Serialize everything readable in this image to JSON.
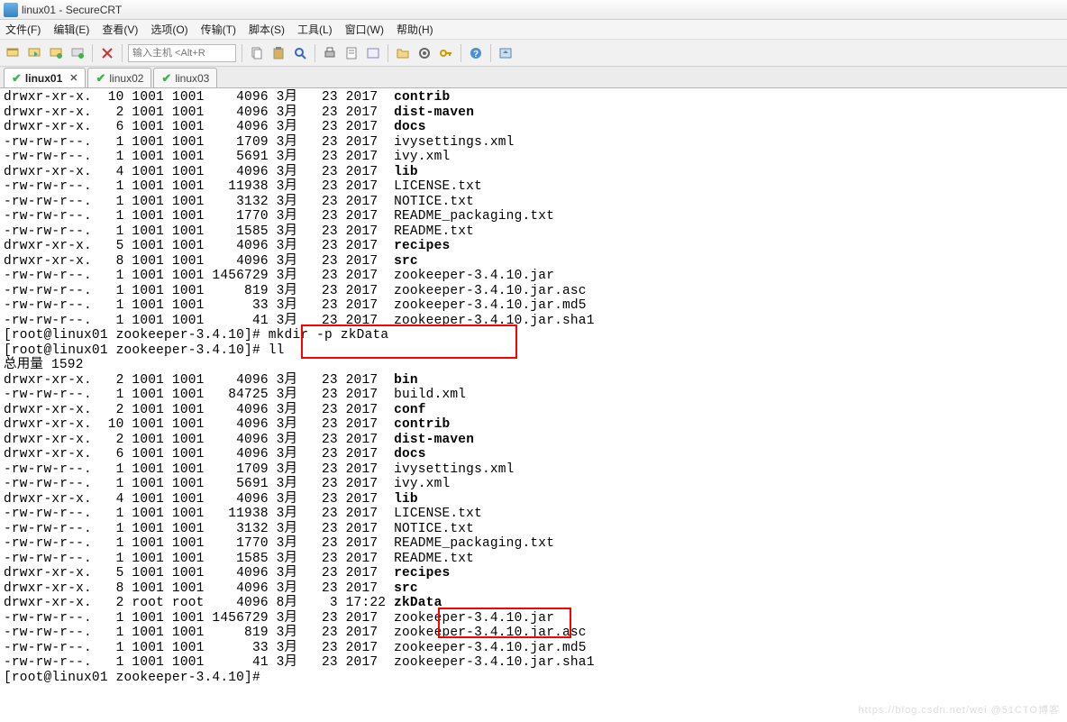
{
  "window": {
    "title": "linux01 - SecureCRT"
  },
  "menu": {
    "file": "文件(F)",
    "edit": "编辑(E)",
    "view": "查看(V)",
    "options": "选项(O)",
    "transfer": "传输(T)",
    "script": "脚本(S)",
    "tools": "工具(L)",
    "window": "窗口(W)",
    "help": "帮助(H)"
  },
  "toolbar": {
    "host_placeholder": "输入主机 <Alt+R"
  },
  "tabs": [
    {
      "label": "linux01",
      "active": true
    },
    {
      "label": "linux02",
      "active": false
    },
    {
      "label": "linux03",
      "active": false
    }
  ],
  "listing_top": [
    {
      "perm": "drwxr-xr-x.",
      "links": "10",
      "own": "1001",
      "grp": "1001",
      "size": "4096",
      "month": "3月",
      "day": "23",
      "time": "2017",
      "name": "contrib",
      "bold": true
    },
    {
      "perm": "drwxr-xr-x.",
      "links": "2",
      "own": "1001",
      "grp": "1001",
      "size": "4096",
      "month": "3月",
      "day": "23",
      "time": "2017",
      "name": "dist-maven",
      "bold": true
    },
    {
      "perm": "drwxr-xr-x.",
      "links": "6",
      "own": "1001",
      "grp": "1001",
      "size": "4096",
      "month": "3月",
      "day": "23",
      "time": "2017",
      "name": "docs",
      "bold": true
    },
    {
      "perm": "-rw-rw-r--.",
      "links": "1",
      "own": "1001",
      "grp": "1001",
      "size": "1709",
      "month": "3月",
      "day": "23",
      "time": "2017",
      "name": "ivysettings.xml",
      "bold": false
    },
    {
      "perm": "-rw-rw-r--.",
      "links": "1",
      "own": "1001",
      "grp": "1001",
      "size": "5691",
      "month": "3月",
      "day": "23",
      "time": "2017",
      "name": "ivy.xml",
      "bold": false
    },
    {
      "perm": "drwxr-xr-x.",
      "links": "4",
      "own": "1001",
      "grp": "1001",
      "size": "4096",
      "month": "3月",
      "day": "23",
      "time": "2017",
      "name": "lib",
      "bold": true
    },
    {
      "perm": "-rw-rw-r--.",
      "links": "1",
      "own": "1001",
      "grp": "1001",
      "size": "11938",
      "month": "3月",
      "day": "23",
      "time": "2017",
      "name": "LICENSE.txt",
      "bold": false
    },
    {
      "perm": "-rw-rw-r--.",
      "links": "1",
      "own": "1001",
      "grp": "1001",
      "size": "3132",
      "month": "3月",
      "day": "23",
      "time": "2017",
      "name": "NOTICE.txt",
      "bold": false
    },
    {
      "perm": "-rw-rw-r--.",
      "links": "1",
      "own": "1001",
      "grp": "1001",
      "size": "1770",
      "month": "3月",
      "day": "23",
      "time": "2017",
      "name": "README_packaging.txt",
      "bold": false
    },
    {
      "perm": "-rw-rw-r--.",
      "links": "1",
      "own": "1001",
      "grp": "1001",
      "size": "1585",
      "month": "3月",
      "day": "23",
      "time": "2017",
      "name": "README.txt",
      "bold": false
    },
    {
      "perm": "drwxr-xr-x.",
      "links": "5",
      "own": "1001",
      "grp": "1001",
      "size": "4096",
      "month": "3月",
      "day": "23",
      "time": "2017",
      "name": "recipes",
      "bold": true
    },
    {
      "perm": "drwxr-xr-x.",
      "links": "8",
      "own": "1001",
      "grp": "1001",
      "size": "4096",
      "month": "3月",
      "day": "23",
      "time": "2017",
      "name": "src",
      "bold": true
    },
    {
      "perm": "-rw-rw-r--.",
      "links": "1",
      "own": "1001",
      "grp": "1001",
      "size": "1456729",
      "month": "3月",
      "day": "23",
      "time": "2017",
      "name": "zookeeper-3.4.10.jar",
      "bold": false
    },
    {
      "perm": "-rw-rw-r--.",
      "links": "1",
      "own": "1001",
      "grp": "1001",
      "size": "819",
      "month": "3月",
      "day": "23",
      "time": "2017",
      "name": "zookeeper-3.4.10.jar.asc",
      "bold": false
    },
    {
      "perm": "-rw-rw-r--.",
      "links": "1",
      "own": "1001",
      "grp": "1001",
      "size": "33",
      "month": "3月",
      "day": "23",
      "time": "2017",
      "name": "zookeeper-3.4.10.jar.md5",
      "bold": false
    },
    {
      "perm": "-rw-rw-r--.",
      "links": "1",
      "own": "1001",
      "grp": "1001",
      "size": "41",
      "month": "3月",
      "day": "23",
      "time": "2017",
      "name": "zookeeper-3.4.10.jar.sha1",
      "bold": false
    }
  ],
  "prompt1": {
    "prefix": "[root@linux01 zookeeper-3.4.10]# ",
    "cmd": "mkdir -p zkData"
  },
  "prompt2": {
    "prefix": "[root@linux01 zookeeper-3.4.10]# ",
    "cmd": "ll"
  },
  "total_line": "总用量 1592",
  "listing_bottom": [
    {
      "perm": "drwxr-xr-x.",
      "links": "2",
      "own": "1001",
      "grp": "1001",
      "size": "4096",
      "month": "3月",
      "day": "23",
      "time": "2017",
      "name": "bin",
      "bold": true
    },
    {
      "perm": "-rw-rw-r--.",
      "links": "1",
      "own": "1001",
      "grp": "1001",
      "size": "84725",
      "month": "3月",
      "day": "23",
      "time": "2017",
      "name": "build.xml",
      "bold": false
    },
    {
      "perm": "drwxr-xr-x.",
      "links": "2",
      "own": "1001",
      "grp": "1001",
      "size": "4096",
      "month": "3月",
      "day": "23",
      "time": "2017",
      "name": "conf",
      "bold": true
    },
    {
      "perm": "drwxr-xr-x.",
      "links": "10",
      "own": "1001",
      "grp": "1001",
      "size": "4096",
      "month": "3月",
      "day": "23",
      "time": "2017",
      "name": "contrib",
      "bold": true
    },
    {
      "perm": "drwxr-xr-x.",
      "links": "2",
      "own": "1001",
      "grp": "1001",
      "size": "4096",
      "month": "3月",
      "day": "23",
      "time": "2017",
      "name": "dist-maven",
      "bold": true
    },
    {
      "perm": "drwxr-xr-x.",
      "links": "6",
      "own": "1001",
      "grp": "1001",
      "size": "4096",
      "month": "3月",
      "day": "23",
      "time": "2017",
      "name": "docs",
      "bold": true
    },
    {
      "perm": "-rw-rw-r--.",
      "links": "1",
      "own": "1001",
      "grp": "1001",
      "size": "1709",
      "month": "3月",
      "day": "23",
      "time": "2017",
      "name": "ivysettings.xml",
      "bold": false
    },
    {
      "perm": "-rw-rw-r--.",
      "links": "1",
      "own": "1001",
      "grp": "1001",
      "size": "5691",
      "month": "3月",
      "day": "23",
      "time": "2017",
      "name": "ivy.xml",
      "bold": false
    },
    {
      "perm": "drwxr-xr-x.",
      "links": "4",
      "own": "1001",
      "grp": "1001",
      "size": "4096",
      "month": "3月",
      "day": "23",
      "time": "2017",
      "name": "lib",
      "bold": true
    },
    {
      "perm": "-rw-rw-r--.",
      "links": "1",
      "own": "1001",
      "grp": "1001",
      "size": "11938",
      "month": "3月",
      "day": "23",
      "time": "2017",
      "name": "LICENSE.txt",
      "bold": false
    },
    {
      "perm": "-rw-rw-r--.",
      "links": "1",
      "own": "1001",
      "grp": "1001",
      "size": "3132",
      "month": "3月",
      "day": "23",
      "time": "2017",
      "name": "NOTICE.txt",
      "bold": false
    },
    {
      "perm": "-rw-rw-r--.",
      "links": "1",
      "own": "1001",
      "grp": "1001",
      "size": "1770",
      "month": "3月",
      "day": "23",
      "time": "2017",
      "name": "README_packaging.txt",
      "bold": false
    },
    {
      "perm": "-rw-rw-r--.",
      "links": "1",
      "own": "1001",
      "grp": "1001",
      "size": "1585",
      "month": "3月",
      "day": "23",
      "time": "2017",
      "name": "README.txt",
      "bold": false
    },
    {
      "perm": "drwxr-xr-x.",
      "links": "5",
      "own": "1001",
      "grp": "1001",
      "size": "4096",
      "month": "3月",
      "day": "23",
      "time": "2017",
      "name": "recipes",
      "bold": true
    },
    {
      "perm": "drwxr-xr-x.",
      "links": "8",
      "own": "1001",
      "grp": "1001",
      "size": "4096",
      "month": "3月",
      "day": "23",
      "time": "2017",
      "name": "src",
      "bold": true
    },
    {
      "perm": "drwxr-xr-x.",
      "links": "2",
      "own": "root",
      "grp": "root",
      "size": "4096",
      "month": "8月",
      "day": "3",
      "time": "17:22",
      "name": "zkData",
      "bold": true
    },
    {
      "perm": "-rw-rw-r--.",
      "links": "1",
      "own": "1001",
      "grp": "1001",
      "size": "1456729",
      "month": "3月",
      "day": "23",
      "time": "2017",
      "name": "zookeeper-3.4.10.jar",
      "bold": false
    },
    {
      "perm": "-rw-rw-r--.",
      "links": "1",
      "own": "1001",
      "grp": "1001",
      "size": "819",
      "month": "3月",
      "day": "23",
      "time": "2017",
      "name": "zookeeper-3.4.10.jar.asc",
      "bold": false
    },
    {
      "perm": "-rw-rw-r--.",
      "links": "1",
      "own": "1001",
      "grp": "1001",
      "size": "33",
      "month": "3月",
      "day": "23",
      "time": "2017",
      "name": "zookeeper-3.4.10.jar.md5",
      "bold": false
    },
    {
      "perm": "-rw-rw-r--.",
      "links": "1",
      "own": "1001",
      "grp": "1001",
      "size": "41",
      "month": "3月",
      "day": "23",
      "time": "2017",
      "name": "zookeeper-3.4.10.jar.sha1",
      "bold": false
    }
  ],
  "prompt3": {
    "prefix": "[root@linux01 zookeeper-3.4.10]#",
    "cmd": " "
  },
  "watermark": "https://blog.csdn.net/wei   @51CTO博客"
}
